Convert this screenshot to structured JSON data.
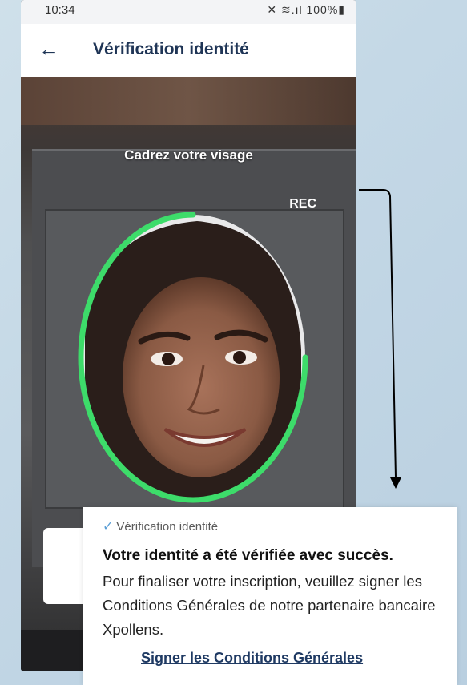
{
  "status_bar": {
    "time": "10:34",
    "icons": "✕ ≋.ıl 100%▮"
  },
  "header": {
    "back_icon": "arrow-left-icon",
    "title": "Vérification identité"
  },
  "camera": {
    "instruction": "Cadrez votre visage",
    "rec_label": "REC",
    "frame_color": "#3ddc6a"
  },
  "success_card": {
    "step_label": "Vérification identité",
    "title": "Votre identité a été vérifiée avec succès.",
    "body": "Pour finaliser votre inscription, veuillez signer les Conditions Générales de notre partenaire bancaire Xpollens.",
    "link_label": "Signer les Conditions Générales",
    "check_color": "#5b9fd6",
    "link_color": "#1f3a63"
  }
}
